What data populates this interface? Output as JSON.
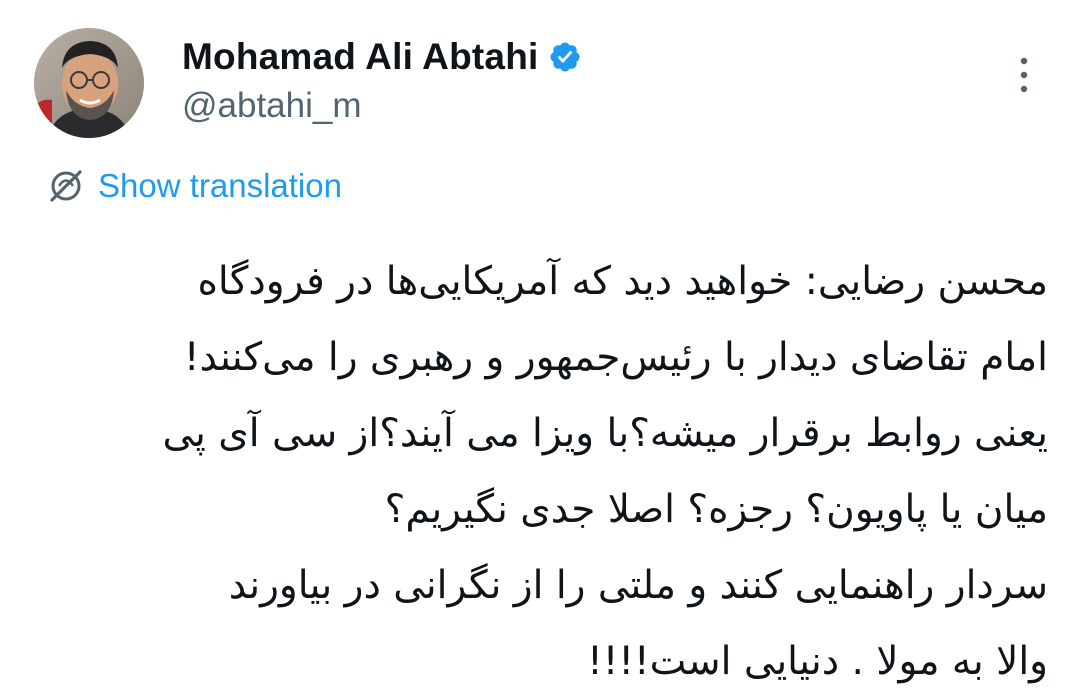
{
  "author": {
    "display_name": "Mohamad Ali Abtahi",
    "handle": "@abtahi_m",
    "verified": true,
    "avatar_icon": "profile-photo"
  },
  "icons": {
    "verified": "verified-badge-icon",
    "more": "more-vertical-icon",
    "translate": "globe-off-icon"
  },
  "translation": {
    "label": "Show translation"
  },
  "tweet": {
    "lines": [
      "محسن رضایی: خواهید دید که آمریکایی‌ها در فرودگاه",
      "امام تقاضای دیدار با رئیس‌جمهور و رهبری را می‌کنند!",
      "یعنی روابط برقرار میشه؟با ویزا می آیند؟از سی آی پی",
      "میان یا پاویون؟ رجزه؟ اصلا جدی نگیریم؟",
      "سردار راهنمایی کنند و ملتی را از نگرانی در بیاورند",
      "والا به مولا . دنیایی است!!!!"
    ]
  },
  "colors": {
    "accent": "#1d9bf0",
    "text_primary": "#0f1419",
    "text_secondary": "#536471",
    "background": "#ffffff"
  }
}
